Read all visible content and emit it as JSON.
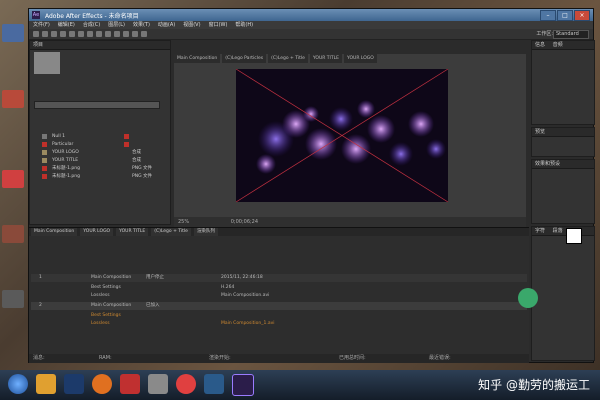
{
  "window": {
    "title": "Adobe After Effects - 未命名项目"
  },
  "menu": [
    "文件(F)",
    "编辑(E)",
    "合成(C)",
    "图层(L)",
    "效果(T)",
    "动画(A)",
    "视图(V)",
    "窗口(W)",
    "帮助(H)"
  ],
  "workspace": {
    "label": "工作区:",
    "value": "Standard"
  },
  "project": {
    "header": "项目",
    "items": [
      {
        "name": "Null 1",
        "type": "",
        "color": "#777777"
      },
      {
        "name": "Particular",
        "type": "",
        "color": "#c0302a"
      },
      {
        "name": "YOUR LOGO",
        "type": "合成",
        "color": "#9a8a60"
      },
      {
        "name": "YOUR TITLE",
        "type": "合成",
        "color": "#9a8a60"
      },
      {
        "name": "未标题-1.png",
        "type": "PNG 文件",
        "color": "#c0302a"
      },
      {
        "name": "未标题-1.png",
        "type": "PNG 文件",
        "color": "#c0302a"
      }
    ]
  },
  "composition": {
    "tabs": [
      "Main Composition",
      "(C)Lego Particles",
      "(C)Lego + Title",
      "YOUR TITLE",
      "YOUR LOGO"
    ],
    "zoom": "25%",
    "timecode": "0;00;06;24"
  },
  "right_panels": {
    "info": "信息",
    "audio": "音频",
    "preview": "预览",
    "effects": "效果和预设",
    "character": "字符",
    "paragraph": "段落"
  },
  "timeline": {
    "tabs": [
      "Main Composition",
      "YOUR LOGO",
      "YOUR TITLE",
      "(C)Lego + Title",
      "渲染队列"
    ],
    "rows": [
      {
        "num": "1",
        "name": "Main Composition",
        "status": "用户停止",
        "extra": "2015/11, 22:46:18"
      },
      {
        "num": "",
        "name": "Best Settings",
        "status": "",
        "extra": "H.264"
      },
      {
        "num": "",
        "name": "Lossless",
        "status": "",
        "extra": "Main Composition.avi"
      },
      {
        "num": "2",
        "name": "Main Composition",
        "status": "已加入",
        "extra": ""
      },
      {
        "num": "",
        "name": "Best Settings",
        "status": "",
        "extra": ""
      },
      {
        "num": "",
        "name": "Lossless",
        "status": "",
        "extra": "Main Composition_1.avi"
      }
    ]
  },
  "status_footer": {
    "msg": "消息:",
    "ram": "RAM:",
    "render_start": "渲染开始:",
    "total": "已用总时间:",
    "last_error": "最近错误:"
  },
  "watermark": "知乎 @勤劳的搬运工"
}
